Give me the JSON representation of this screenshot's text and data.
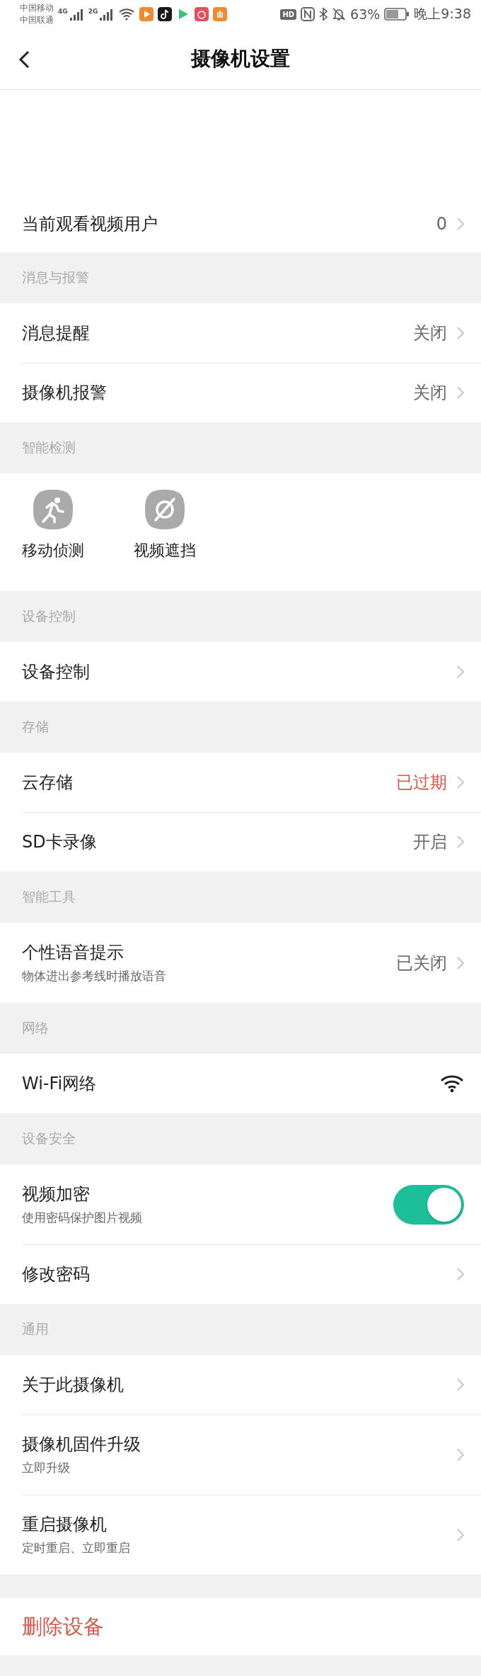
{
  "status_bar": {
    "carriers": [
      "中国移动",
      "中国联通"
    ],
    "networks": [
      "4G",
      "2G"
    ],
    "hd": "HD",
    "battery": "63%",
    "time": "晚上9:38"
  },
  "header": {
    "title": "摄像机设置"
  },
  "top_row": {
    "label": "当前观看视频用户",
    "value": "0"
  },
  "sections": [
    {
      "title": "消息与报警",
      "kind": "list",
      "rows": [
        {
          "kind": "nav",
          "label": "消息提醒",
          "value": "关闭",
          "warning": false
        },
        {
          "kind": "nav",
          "label": "摄像机报警",
          "value": "关闭",
          "warning": false
        }
      ]
    },
    {
      "title": "智能检测",
      "kind": "grid",
      "features": [
        {
          "kind": "motion",
          "label": "移动侦测"
        },
        {
          "kind": "occlusion",
          "label": "视频遮挡"
        }
      ]
    },
    {
      "title": "设备控制",
      "kind": "list",
      "rows": [
        {
          "kind": "nav",
          "label": "设备控制"
        }
      ]
    },
    {
      "title": "存储",
      "kind": "list",
      "rows": [
        {
          "kind": "nav",
          "label": "云存储",
          "value": "已过期",
          "warning": true
        },
        {
          "kind": "nav",
          "label": "SD卡录像",
          "value": "开启",
          "warning": false
        }
      ]
    },
    {
      "title": "智能工具",
      "kind": "list",
      "rows": [
        {
          "kind": "nav",
          "label": "个性语音提示",
          "subtitle": "物体进出参考线时播放语音",
          "value": "已关闭",
          "warning": false
        }
      ]
    },
    {
      "title": "网络",
      "kind": "list",
      "rows": [
        {
          "kind": "wifi",
          "label": "Wi-Fi网络"
        }
      ]
    },
    {
      "title": "设备安全",
      "kind": "list",
      "rows": [
        {
          "kind": "toggle",
          "label": "视频加密",
          "subtitle": "使用密码保护图片视频",
          "on": true
        },
        {
          "kind": "nav",
          "label": "修改密码"
        }
      ]
    },
    {
      "title": "通用",
      "kind": "list",
      "rows": [
        {
          "kind": "nav",
          "label": "关于此摄像机"
        },
        {
          "kind": "nav",
          "label": "摄像机固件升级",
          "subtitle": "立即升级"
        },
        {
          "kind": "nav",
          "label": "重启摄像机",
          "subtitle": "定时重启、立即重启"
        }
      ]
    }
  ],
  "delete_button": {
    "label": "删除设备"
  }
}
